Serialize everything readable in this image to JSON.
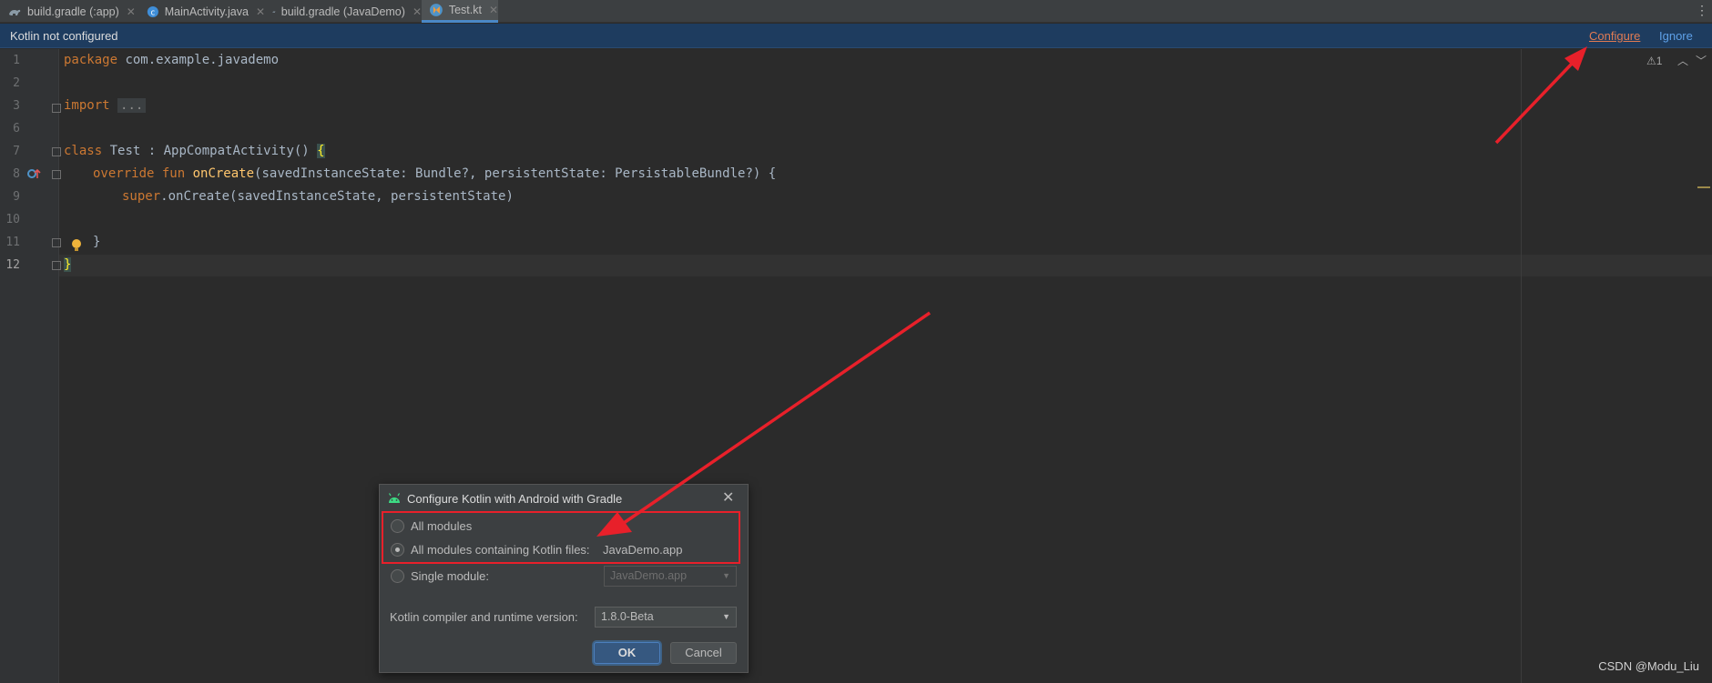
{
  "tabs": [
    {
      "label": "build.gradle (:app)",
      "icon": "gradle-icon",
      "active": false
    },
    {
      "label": "MainActivity.java",
      "icon": "java-class-icon",
      "active": false
    },
    {
      "label": "build.gradle (JavaDemo)",
      "icon": "gradle-icon",
      "active": false
    },
    {
      "label": "Test.kt",
      "icon": "kotlin-file-icon",
      "active": true
    }
  ],
  "banner": {
    "message": "Kotlin not configured",
    "configure": "Configure",
    "ignore": "Ignore"
  },
  "inspection": {
    "warnings": "⚠1"
  },
  "editor": {
    "line_numbers": [
      "1",
      "2",
      "3",
      "6",
      "7",
      "8",
      "9",
      "10",
      "11",
      "12"
    ],
    "code": {
      "l1_kw": "package",
      "l1_rest": " com.example.javademo",
      "l3_kw": "import",
      "l3_rest": "...",
      "l7_kw": "class",
      "l7_rest": " Test : AppCompatActivity() ",
      "l7_brace": "{",
      "l8_kw": "override fun",
      "l8_fn": "onCreate",
      "l8_rest": "(savedInstanceState: Bundle?, persistentState: PersistableBundle?) {",
      "l9_kw": "super",
      "l9_rest": ".onCreate(savedInstanceState, persistentState)",
      "l11": "}",
      "l12": "}"
    }
  },
  "dialog": {
    "title": "Configure Kotlin with Android with Gradle",
    "option_all": "All modules",
    "option_kotlin": "All modules containing Kotlin files:",
    "option_kotlin_value": "JavaDemo.app",
    "option_single": "Single module:",
    "single_module_value": "JavaDemo.app",
    "version_label": "Kotlin compiler and runtime version:",
    "version_value": "1.8.0-Beta",
    "ok": "OK",
    "cancel": "Cancel"
  },
  "watermark": "CSDN @Modu_Liu",
  "colors": {
    "banner_bg": "#1e3c5f",
    "keyword": "#cc7832",
    "function": "#ffc66d",
    "annotation_red": "#e8202a"
  }
}
